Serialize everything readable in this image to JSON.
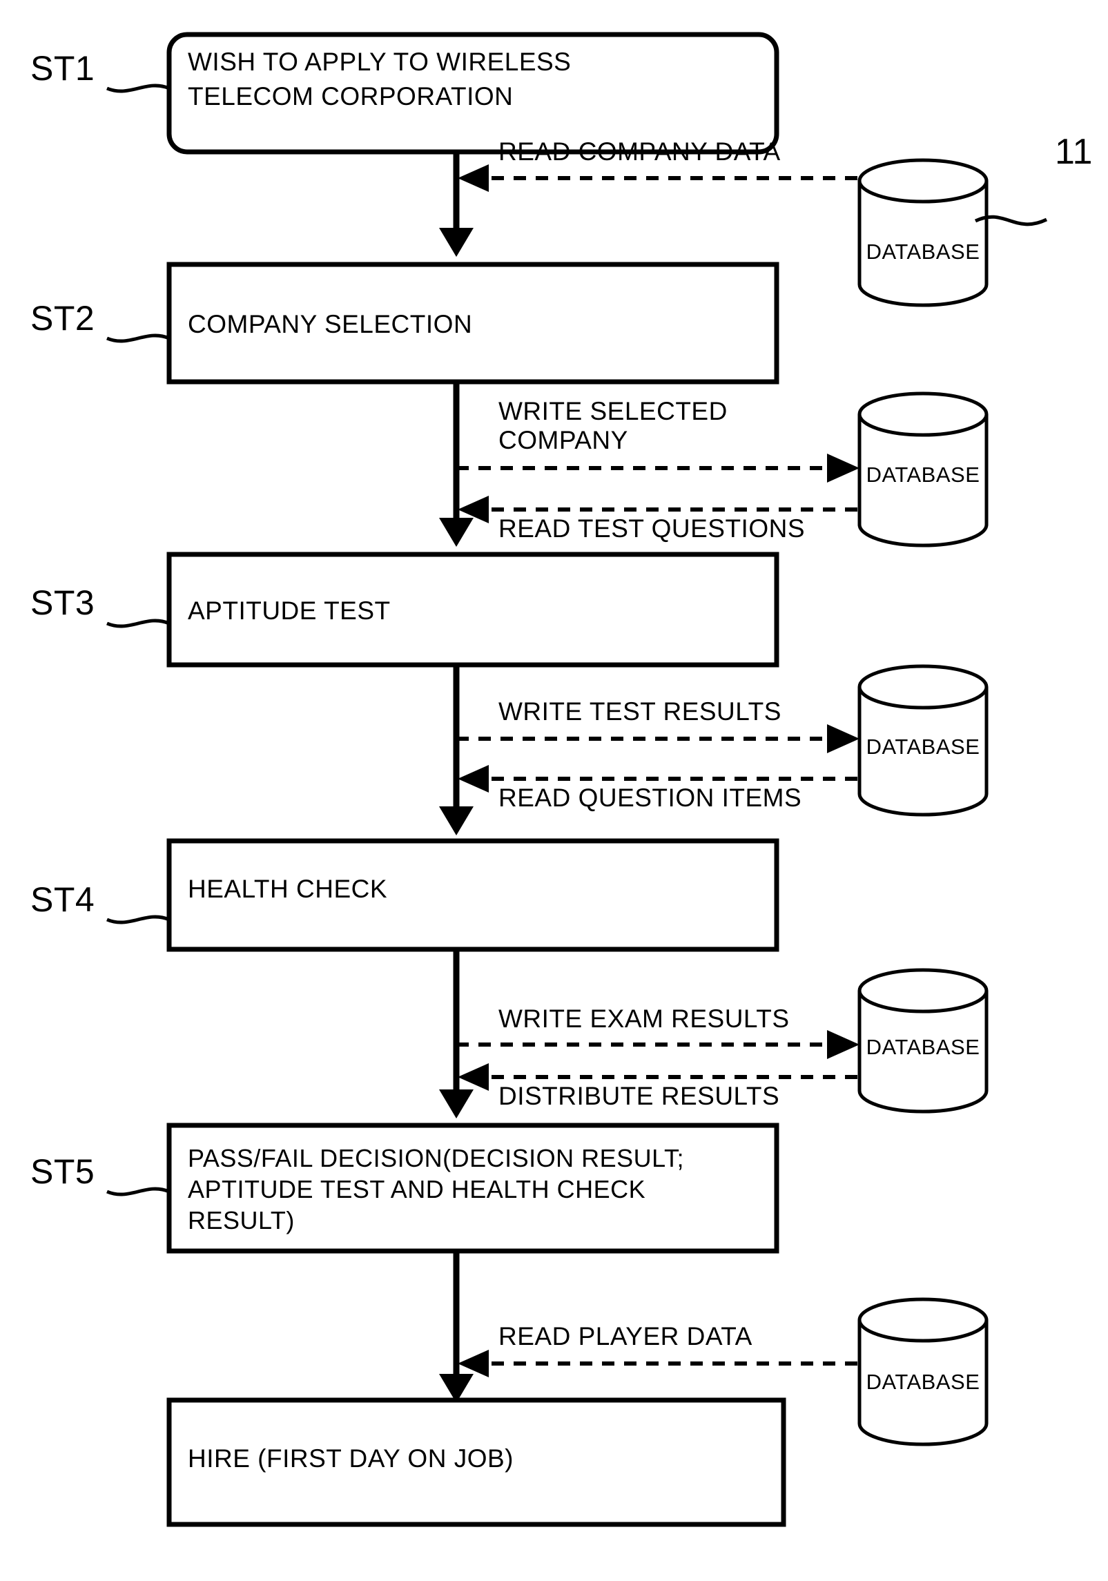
{
  "figure": {
    "type": "flowchart",
    "reference_numeral": "11",
    "reference_target": "database-cylinder-1"
  },
  "steps": [
    {
      "id": "ST1",
      "label": "ST1",
      "shape": "rounded-rect",
      "lines": [
        "WISH TO APPLY TO WIRELESS",
        "TELECOM CORPORATION"
      ]
    },
    {
      "id": "ST2",
      "label": "ST2",
      "shape": "rect",
      "lines": [
        "COMPANY SELECTION"
      ]
    },
    {
      "id": "ST3",
      "label": "ST3",
      "shape": "rect",
      "lines": [
        "APTITUDE TEST"
      ]
    },
    {
      "id": "ST4",
      "label": "ST4",
      "shape": "rect",
      "lines": [
        "HEALTH CHECK"
      ]
    },
    {
      "id": "ST5",
      "label": "ST5",
      "shape": "rect",
      "lines": [
        "PASS/FAIL DECISION(DECISION RESULT;",
        "APTITUDE TEST AND HEALTH CHECK",
        "RESULT)"
      ]
    },
    {
      "id": "ST6",
      "label": "",
      "shape": "rect",
      "lines": [
        "HIRE (FIRST DAY ON JOB)"
      ]
    }
  ],
  "databases": [
    {
      "id": "db1",
      "label": "DATABASE"
    },
    {
      "id": "db2",
      "label": "DATABASE"
    },
    {
      "id": "db3",
      "label": "DATABASE"
    },
    {
      "id": "db4",
      "label": "DATABASE"
    },
    {
      "id": "db5",
      "label": "DATABASE"
    }
  ],
  "data_flows": [
    {
      "id": "f1",
      "label": "READ COMPANY DATA",
      "direction": "from-database",
      "database": "db1",
      "between": "ST1-ST2"
    },
    {
      "id": "f2",
      "label_line1": "WRITE SELECTED",
      "label_line2": "COMPANY",
      "direction": "to-database",
      "database": "db2",
      "between": "ST2-ST3"
    },
    {
      "id": "f3",
      "label": "READ TEST QUESTIONS",
      "direction": "from-database",
      "database": "db2",
      "between": "ST2-ST3"
    },
    {
      "id": "f4",
      "label": "WRITE TEST RESULTS",
      "direction": "to-database",
      "database": "db3",
      "between": "ST3-ST4"
    },
    {
      "id": "f5",
      "label": "READ QUESTION ITEMS",
      "direction": "from-database",
      "database": "db3",
      "between": "ST3-ST4"
    },
    {
      "id": "f6",
      "label": "WRITE EXAM RESULTS",
      "direction": "to-database",
      "database": "db4",
      "between": "ST4-ST5"
    },
    {
      "id": "f7",
      "label": "DISTRIBUTE RESULTS",
      "direction": "from-database",
      "database": "db4",
      "between": "ST4-ST5"
    },
    {
      "id": "f8",
      "label": "READ PLAYER DATA",
      "direction": "from-database",
      "database": "db5",
      "between": "ST5-ST6"
    }
  ],
  "colors": {
    "stroke": "#000000",
    "background": "#ffffff"
  }
}
